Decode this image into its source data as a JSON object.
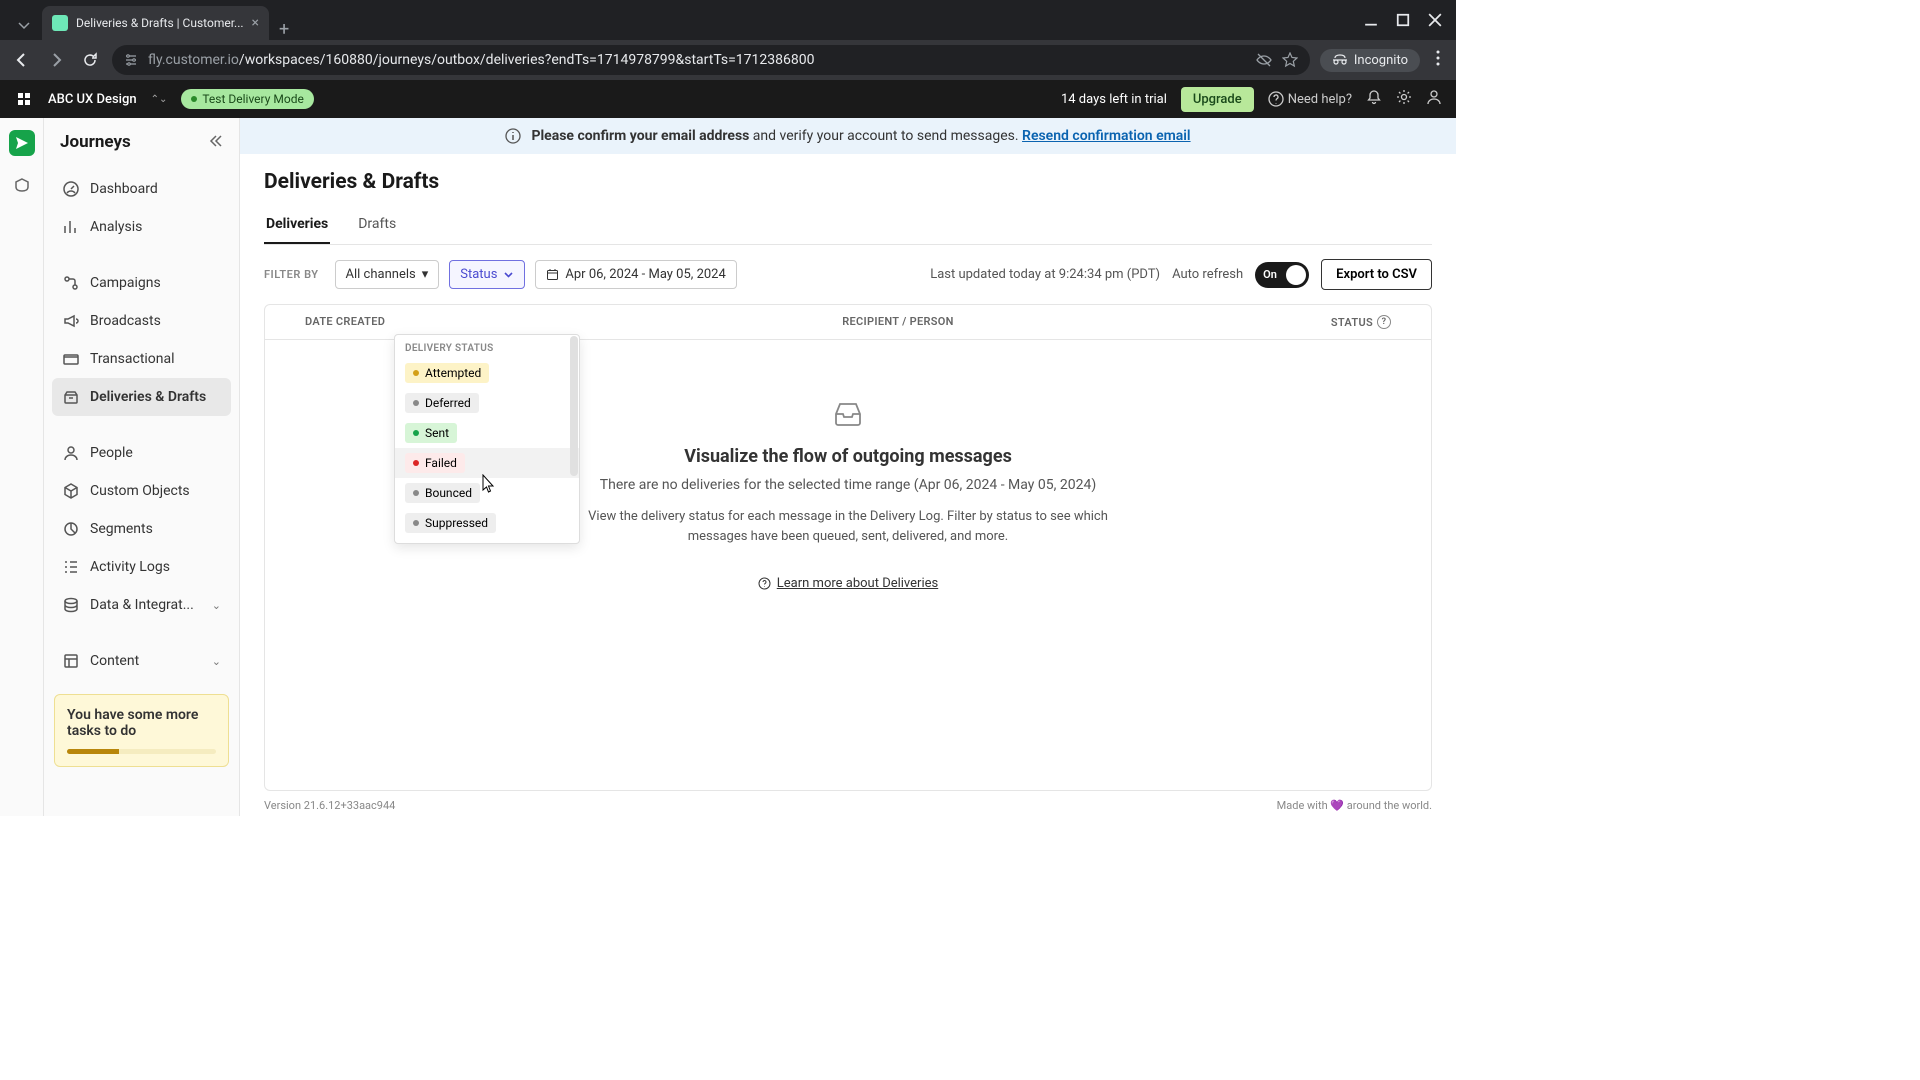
{
  "browser": {
    "tab_title": "Deliveries & Drafts | Customer...",
    "url_domain": "fly.customer.io",
    "url_path": "/workspaces/160880/journeys/outbox/deliveries?endTs=1714978799&startTs=1712386800",
    "incognito": "Incognito"
  },
  "topbar": {
    "workspace": "ABC UX Design",
    "test_mode": "Test Delivery Mode",
    "trial": "14 days left in trial",
    "upgrade": "Upgrade",
    "help": "Need help?"
  },
  "sidebar": {
    "title": "Journeys",
    "items": {
      "dashboard": "Dashboard",
      "analysis": "Analysis",
      "campaigns": "Campaigns",
      "broadcasts": "Broadcasts",
      "transactional": "Transactional",
      "deliveries": "Deliveries & Drafts",
      "people": "People",
      "custom_objects": "Custom Objects",
      "segments": "Segments",
      "activity_logs": "Activity Logs",
      "data": "Data & Integrat...",
      "content": "Content"
    },
    "tasks": "You have some more tasks to do"
  },
  "banner": {
    "bold": "Please confirm your email address",
    "text": " and verify your account to send messages. ",
    "link": "Resend confirmation email"
  },
  "page": {
    "title": "Deliveries & Drafts",
    "tabs": {
      "deliveries": "Deliveries",
      "drafts": "Drafts"
    }
  },
  "filters": {
    "label": "FILTER BY",
    "channels": "All channels",
    "status": "Status",
    "date_range": "Apr 06, 2024 - May 05, 2024",
    "updated": "Last updated today at 9:24:34 pm (PDT)",
    "auto_refresh": "Auto refresh",
    "toggle": "On",
    "export": "Export to CSV"
  },
  "dropdown": {
    "head": "DELIVERY STATUS",
    "attempted": "Attempted",
    "deferred": "Deferred",
    "sent": "Sent",
    "failed": "Failed",
    "bounced": "Bounced",
    "suppressed": "Suppressed"
  },
  "table": {
    "date": "DATE CREATED",
    "recipient": "RECIPIENT / PERSON",
    "status": "STATUS"
  },
  "empty": {
    "title": "Visualize the flow of outgoing messages",
    "sub": "There are no deliveries for the selected time range (Apr 06, 2024 - May 05, 2024)",
    "desc": "View the delivery status for each message in the Delivery Log. Filter by status to see which messages have been queued, sent, delivered, and more.",
    "learn": "Learn more about Deliveries"
  },
  "footer": {
    "version": "Version 21.6.12+33aac944",
    "made": "Made with 💜 around the world."
  }
}
